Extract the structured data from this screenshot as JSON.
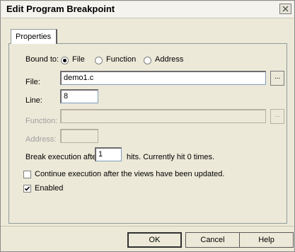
{
  "window": {
    "title": "Edit Program Breakpoint",
    "close_icon": "close-icon"
  },
  "tabs": [
    {
      "label": "Properties",
      "selected": true
    }
  ],
  "bound_to": {
    "label": "Bound to:",
    "options": [
      {
        "label": "File",
        "selected": true
      },
      {
        "label": "Function",
        "selected": false
      },
      {
        "label": "Address",
        "selected": false
      }
    ]
  },
  "file": {
    "label": "File:",
    "value": "demo1.c",
    "browse_label": "..."
  },
  "line": {
    "label": "Line:",
    "value": "8"
  },
  "function": {
    "label": "Function:",
    "value": "",
    "browse_label": "...",
    "enabled": false
  },
  "address": {
    "label": "Address:",
    "value": "",
    "enabled": false
  },
  "break_after": {
    "label": "Break execution after:",
    "value": "1",
    "suffix": "hits. Currently hit 0 times."
  },
  "continue_execution": {
    "label": "Continue execution after the views have been updated.",
    "checked": false
  },
  "enabled": {
    "label": "Enabled",
    "checked": true
  },
  "buttons": {
    "ok": "OK",
    "cancel": "Cancel",
    "help": "Help"
  }
}
